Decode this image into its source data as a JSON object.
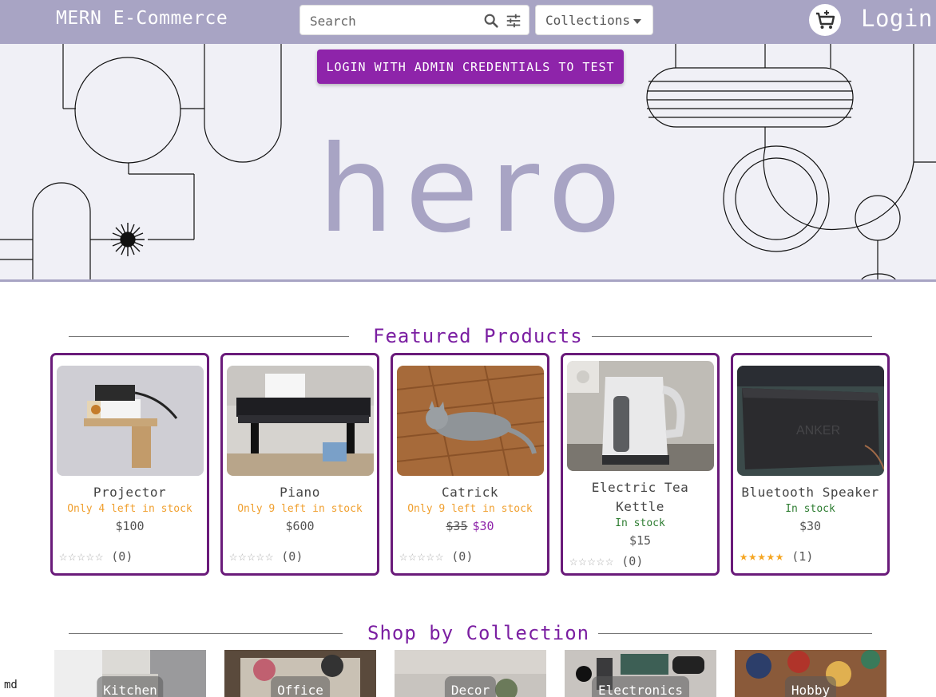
{
  "navbar": {
    "brand": "MERN E-Commerce",
    "search_placeholder": "Search",
    "collections_label": "Collections",
    "login_label": "Login"
  },
  "hero": {
    "admin_button": "LOGIN WITH ADMIN CREDENTIALS TO TEST",
    "word": "hero"
  },
  "featured": {
    "title": "Featured Products",
    "products": [
      {
        "name": "Projector",
        "stock": "Only 4 left in stock",
        "price": "$100",
        "stars_filled": 0,
        "reviews": "(0)"
      },
      {
        "name": "Piano",
        "stock": "Only 9 left in stock",
        "price": "$600",
        "stars_filled": 0,
        "reviews": "(0)"
      },
      {
        "name": "Catrick",
        "stock": "Only 9 left in stock",
        "old_price": "$35",
        "price": "$30",
        "stars_filled": 0,
        "reviews": "(0)"
      },
      {
        "name": "Electric Tea Kettle",
        "stock": "In stock",
        "price": "$15",
        "stars_filled": 0,
        "reviews": "(0)"
      },
      {
        "name": "Bluetooth Speaker",
        "stock": "In stock",
        "price": "$30",
        "stars_filled": 5,
        "reviews": "(1)"
      }
    ]
  },
  "collections_section": {
    "title": "Shop by Collection",
    "items": [
      "Kitchen",
      "Office",
      "Decor",
      "Electronics",
      "Hobby"
    ]
  },
  "breakpoint_label": "md",
  "colors": {
    "navbar": "#a8a4c4",
    "accent": "#8e24aa",
    "card_border": "#6a1b7a",
    "low_stock": "#f0a030",
    "in_stock": "#2e7d32",
    "star": "#f5a623"
  },
  "icons": [
    "search-icon",
    "filter-icon",
    "cart-icon",
    "star-icon"
  ]
}
